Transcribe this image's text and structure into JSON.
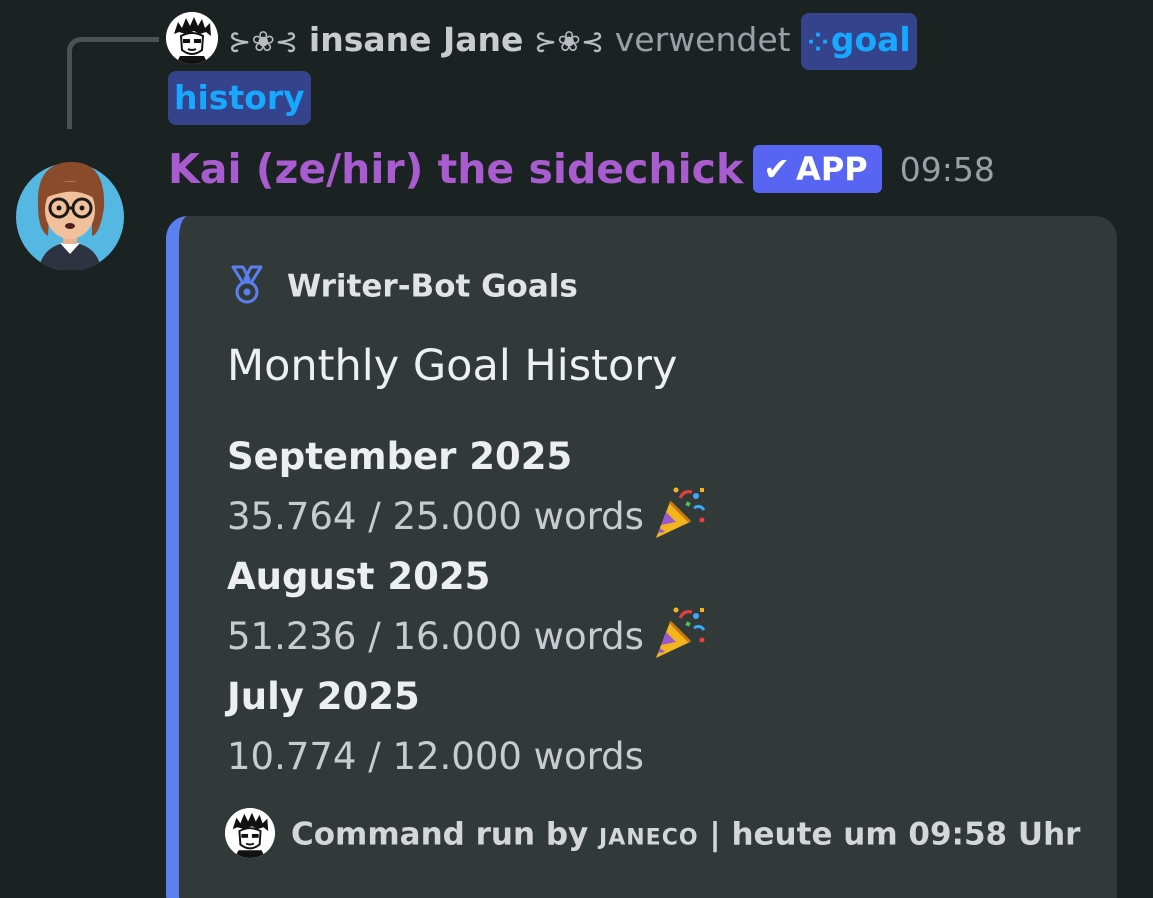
{
  "reply": {
    "deco_left": "⊱❀⊰",
    "user": "insane Jane",
    "deco_right": "⊱❀⊰",
    "action": "verwendet",
    "command_part1": "goal",
    "command_part2": "history"
  },
  "message": {
    "author": "Kai (ze/hir) the sidechick",
    "badge": "APP",
    "timestamp": "09:58",
    "author_color": "#a95bd0"
  },
  "embed": {
    "accent_color": "#5b7ff0",
    "author": "Writer-Bot Goals",
    "author_icon": "medal-icon",
    "title": "Monthly Goal History",
    "goals": [
      {
        "month": "September 2025",
        "progress": "35.764 / 25.000 words",
        "celebrate": true
      },
      {
        "month": "August 2025",
        "progress": "51.236 / 16.000 words",
        "celebrate": true
      },
      {
        "month": "July 2025",
        "progress": "10.774 / 12.000 words",
        "celebrate": false
      }
    ],
    "footer": {
      "prefix": "Command run by",
      "user": "janeco",
      "suffix": "| heute um 09:58 Uhr"
    }
  }
}
